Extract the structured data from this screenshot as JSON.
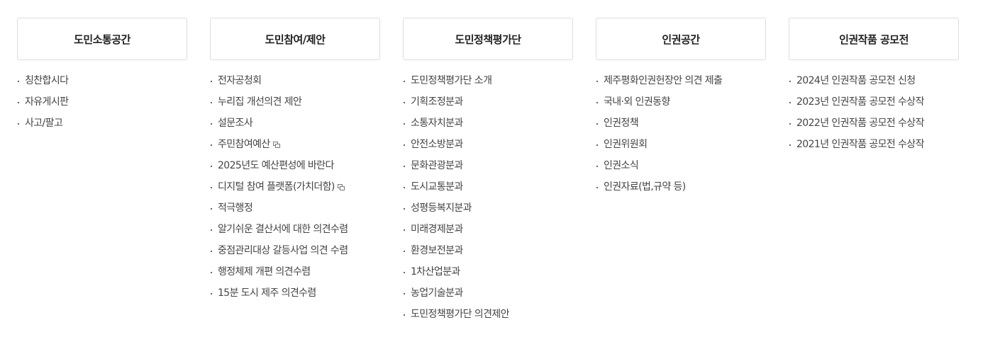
{
  "menu": [
    {
      "title": "도민소통공간",
      "items": [
        {
          "label": "칭찬합시다",
          "external": false
        },
        {
          "label": "자유게시판",
          "external": false
        },
        {
          "label": "사고/팔고",
          "external": false
        }
      ]
    },
    {
      "title": "도민참여/제안",
      "items": [
        {
          "label": "전자공청회",
          "external": false
        },
        {
          "label": "누리집 개선의견 제안",
          "external": false
        },
        {
          "label": "설문조사",
          "external": false
        },
        {
          "label": "주민참여예산",
          "external": true
        },
        {
          "label": "2025년도 예산편성에 바란다",
          "external": false
        },
        {
          "label": "디지털 참여 플랫폼(가치더함)",
          "external": true
        },
        {
          "label": "적극행정",
          "external": false
        },
        {
          "label": "알기쉬운 결산서에 대한 의견수렴",
          "external": false
        },
        {
          "label": "중점관리대상 갈등사업 의견 수렴",
          "external": false
        },
        {
          "label": "행정체제 개편 의견수렴",
          "external": false
        },
        {
          "label": "15분 도시 제주 의견수렴",
          "external": false
        }
      ]
    },
    {
      "title": "도민정책평가단",
      "items": [
        {
          "label": "도민정책평가단 소개",
          "external": false
        },
        {
          "label": "기획조정분과",
          "external": false
        },
        {
          "label": "소통자치분과",
          "external": false
        },
        {
          "label": "안전소방분과",
          "external": false
        },
        {
          "label": "문화관광분과",
          "external": false
        },
        {
          "label": "도시교통분과",
          "external": false
        },
        {
          "label": "성평등복지분과",
          "external": false
        },
        {
          "label": "미래경제분과",
          "external": false
        },
        {
          "label": "환경보전분과",
          "external": false
        },
        {
          "label": "1차산업분과",
          "external": false
        },
        {
          "label": "농업기술분과",
          "external": false
        },
        {
          "label": "도민정책평가단 의견제안",
          "external": false
        }
      ]
    },
    {
      "title": "인권공간",
      "items": [
        {
          "label": "제주평화인권헌장안 의견 제출",
          "external": false
        },
        {
          "label": "국내·외 인권동향",
          "external": false
        },
        {
          "label": "인권정책",
          "external": false
        },
        {
          "label": "인권위원회",
          "external": false
        },
        {
          "label": "인권소식",
          "external": false
        },
        {
          "label": "인권자료(법,규약 등)",
          "external": false
        }
      ]
    },
    {
      "title": "인권작품 공모전",
      "items": [
        {
          "label": "2024년 인권작품 공모전 신청",
          "external": false
        },
        {
          "label": "2023년 인권작품 공모전 수상작",
          "external": false
        },
        {
          "label": "2022년 인권작품 공모전 수상작",
          "external": false
        },
        {
          "label": "2021년 인권작품 공모전 수상작",
          "external": false
        }
      ]
    }
  ],
  "icons": {
    "bullet": "bullet-dot-icon",
    "external": "new-window-icon"
  },
  "colors": {
    "text": "#444444",
    "heading": "#222222",
    "border": "#dddddd"
  }
}
